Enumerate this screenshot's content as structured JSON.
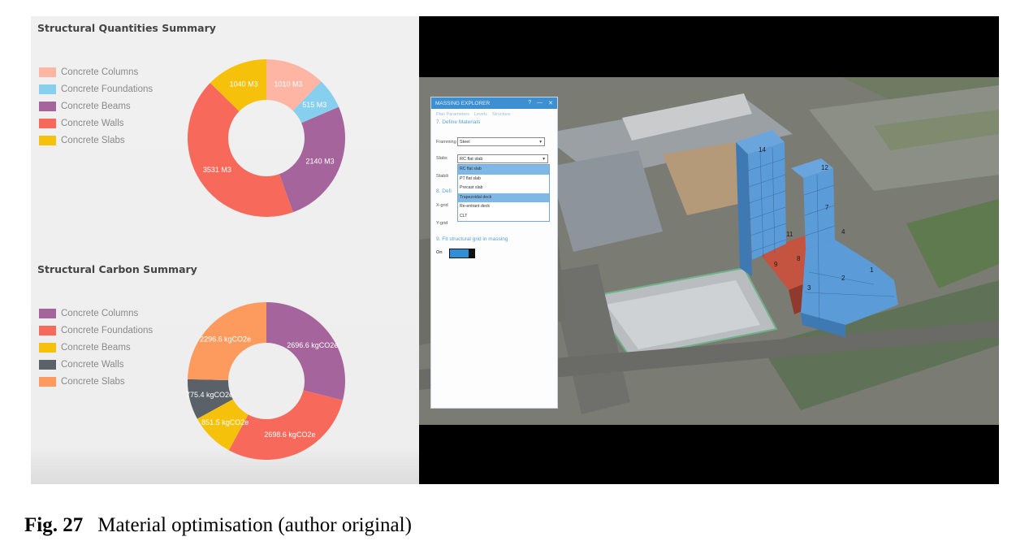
{
  "quantities": {
    "title": "Structural Quantities Summary",
    "legend": [
      {
        "label": "Concrete Columns",
        "color": "#ffb5a4"
      },
      {
        "label": "Concrete Foundations",
        "color": "#87cfee"
      },
      {
        "label": "Concrete Beams",
        "color": "#a6649c"
      },
      {
        "label": "Concrete Walls",
        "color": "#f76a5b"
      },
      {
        "label": "Concrete Slabs",
        "color": "#f6c10a"
      }
    ],
    "chart_data": {
      "type": "pie",
      "donut": true,
      "unit": "M3",
      "slices": [
        {
          "label": "Concrete Columns",
          "value": 1010,
          "display": "1010 M3",
          "color": "#ffb5a4"
        },
        {
          "label": "Concrete Foundations",
          "value": 515,
          "display": "515 M3",
          "color": "#87cfee"
        },
        {
          "label": "Concrete Beams",
          "value": 2140,
          "display": "2140 M3",
          "color": "#a6649c"
        },
        {
          "label": "Concrete Walls",
          "value": 3531,
          "display": "3531 M3",
          "color": "#f76a5b"
        },
        {
          "label": "Concrete Slabs",
          "value": 1040,
          "display": "1040 M3",
          "color": "#f6c10a"
        }
      ]
    }
  },
  "carbon": {
    "title": "Structural Carbon Summary",
    "legend": [
      {
        "label": "Concrete Columns",
        "color": "#a6649c"
      },
      {
        "label": "Concrete Foundations",
        "color": "#f76a5b"
      },
      {
        "label": "Concrete Beams",
        "color": "#f6c10a"
      },
      {
        "label": "Concrete Walls",
        "color": "#5a6169"
      },
      {
        "label": "Concrete Slabs",
        "color": "#fd9a5e"
      }
    ],
    "chart_data": {
      "type": "pie",
      "donut": true,
      "unit": "kgCO2e",
      "slices": [
        {
          "label": "Concrete Columns",
          "value": 2696.6,
          "display": "2696.6 kgCO2e",
          "color": "#a6649c"
        },
        {
          "label": "Concrete Foundations",
          "value": 2698.6,
          "display": "2698.6 kgCO2e",
          "color": "#f76a5b"
        },
        {
          "label": "Concrete Beams",
          "value": 851.5,
          "display": "851.5 kgCO2e",
          "color": "#f6c10a"
        },
        {
          "label": "Concrete Walls",
          "value": 775.4,
          "display": "775.4 kgCO2e",
          "color": "#5a6169"
        },
        {
          "label": "Concrete Slabs",
          "value": 2296.6,
          "display": "2296.6 kgCO2e",
          "color": "#fd9a5e"
        }
      ]
    }
  },
  "explorer": {
    "title": "MASSING EXPLORER",
    "window_controls": [
      "?",
      "—",
      "✕"
    ],
    "tabs": [
      "Plan Parameters",
      "Levels",
      "Structure"
    ],
    "section_materials": "7. Define Materials",
    "framing_label": "Framming",
    "framing_value": "Steel",
    "slabs_label": "Slabs",
    "slabs_value": "RC flat slab",
    "stability_label": "Stabili",
    "grid_section": "8. Defi",
    "xgrid_label": "X-grid",
    "ygrid_label": "Y-grid",
    "slab_options": [
      "RC flat slab",
      "PT flat slab",
      "Precast slab",
      "Trapezoidal deck",
      "Re-entrant deck",
      "CLT"
    ],
    "selected_option_index": 0,
    "hover_option_index": 3,
    "fit_section": "9. Fit structural grid in massing",
    "toggle_label": "On",
    "toggle_state": true
  },
  "tower_labels": [
    "14",
    "12",
    "11",
    "9",
    "8",
    "7",
    "4",
    "3",
    "2",
    "1"
  ],
  "caption": {
    "fig": "Fig. 27",
    "text": "Material optimisation (author original)"
  }
}
